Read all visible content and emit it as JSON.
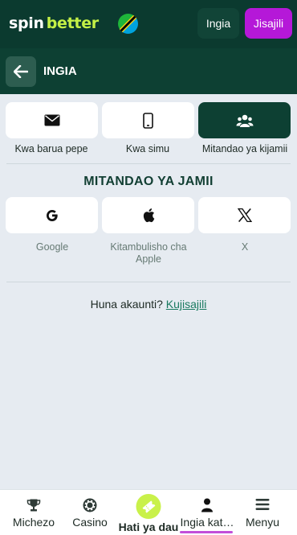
{
  "header": {
    "logo_part1": "spin",
    "logo_part2": "better",
    "login_label": "Ingia",
    "register_label": "Jisajili",
    "colors": {
      "bar": "#0b3a2f",
      "register": "#b518d8",
      "logo_accent": "#c4f046"
    }
  },
  "titlebar": {
    "back_icon": "arrow-left-icon",
    "title": "INGIA"
  },
  "login_methods": [
    {
      "icon": "envelope-icon",
      "label": "Kwa barua pepe",
      "active": false
    },
    {
      "icon": "smartphone-icon",
      "label": "Kwa simu",
      "active": false
    },
    {
      "icon": "users-icon",
      "label": "Mitandao ya kijamii",
      "active": true
    }
  ],
  "social": {
    "title": "MITANDAO YA JAMII",
    "items": [
      {
        "icon": "google-icon",
        "label": "Google"
      },
      {
        "icon": "apple-icon",
        "label": "Kitambulisho cha Apple"
      },
      {
        "icon": "x-icon",
        "label": "X"
      }
    ]
  },
  "signup": {
    "prompt": "Huna akaunti?",
    "link": "Kujisajili"
  },
  "bottom_nav": {
    "items": [
      {
        "icon": "trophy-icon",
        "label": "Michezo"
      },
      {
        "icon": "casino-chip-icon",
        "label": "Casino"
      },
      {
        "icon": "ticket-icon",
        "label": "Hati ya dau"
      },
      {
        "icon": "person-icon",
        "label": "Ingia kat…",
        "active": true
      },
      {
        "icon": "menu-icon",
        "label": "Menyu"
      }
    ]
  }
}
